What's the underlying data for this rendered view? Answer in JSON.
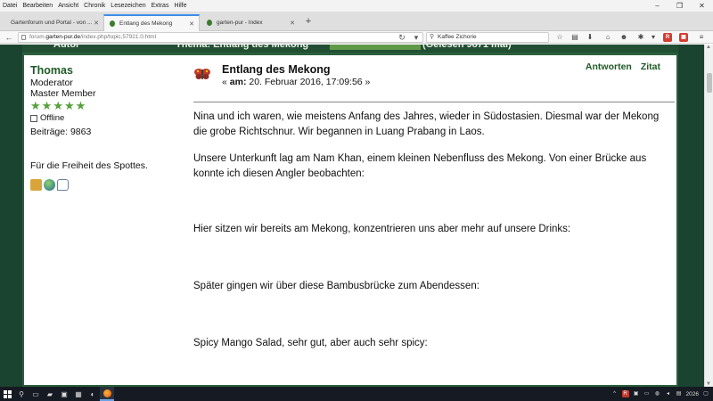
{
  "menu": [
    "Datei",
    "Bearbeiten",
    "Ansicht",
    "Chronik",
    "Lesezeichen",
    "Extras",
    "Hilfe"
  ],
  "tabs": [
    {
      "label": "Gartenforum und Portal - von ...",
      "active": false
    },
    {
      "label": "Entlang des Mekong",
      "active": true
    },
    {
      "label": "garten-pur - Index",
      "active": false
    }
  ],
  "url": {
    "prefix": "forum.",
    "host": "garten-pur.de",
    "path": "/index.php/topic,57921.0.html"
  },
  "search": {
    "value": "Kaffee Zichorie"
  },
  "post": {
    "author": {
      "name": "Thomas",
      "role": "Moderator",
      "rank": "Master Member",
      "stars": 5,
      "status": "Offline",
      "posts_label": "Beiträge: 9863",
      "signature": "Für die Freiheit des Spottes."
    },
    "title": "Entlang des Mekong",
    "date_prefix": "«",
    "date_am": "am:",
    "date_value": "20. Februar 2016, 17:09:56 »",
    "actions": {
      "reply": "Antworten",
      "quote": "Zitat"
    },
    "paragraphs": [
      "Nina und ich waren, wie meistens Anfang des Jahres, wieder in Südostasien. Diesmal war der Mekong die grobe Richtschnur. Wir begannen in Luang Prabang in Laos.",
      "Unsere Unterkunft lag am Nam Khan, einem kleinen Nebenfluss des Mekong. Von einer Brücke aus konnte ich diesen Angler beobachten:",
      "Hier sitzen wir bereits am Mekong, konzentrieren uns aber mehr auf unsere Drinks:",
      "Später gingen wir über diese Bambusbrücke zum Abendessen:",
      "Spicy Mango Salad, sehr gut, aber auch sehr spicy:"
    ]
  },
  "taskbar": {
    "time": "2026"
  }
}
